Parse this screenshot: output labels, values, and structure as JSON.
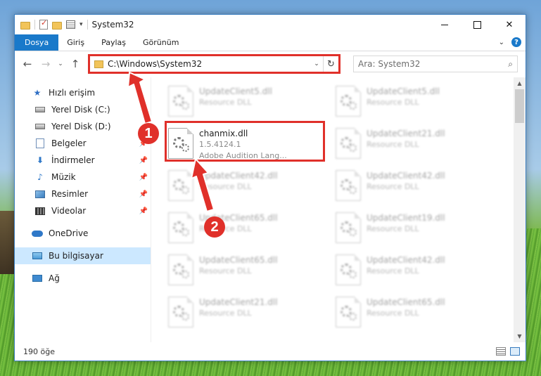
{
  "window": {
    "title": "System32",
    "controls": {
      "minimize": "",
      "maximize": "",
      "close": "✕"
    }
  },
  "quick_access_toolbar": {
    "dropdown": "▾"
  },
  "ribbon": {
    "tabs": [
      "Dosya",
      "Giriş",
      "Paylaş",
      "Görünüm"
    ],
    "expand_chevron": "⌄",
    "help": "?"
  },
  "nav": {
    "back": "←",
    "forward": "→",
    "recent": "⌄",
    "up": "↑",
    "address": "C:\\Windows\\System32",
    "address_dropdown": "⌄",
    "refresh": "↻",
    "search_placeholder": "Ara: System32",
    "search_icon": "⌕"
  },
  "sidebar": {
    "items": [
      {
        "label": "Hızlı erişim",
        "icon": "star-icon"
      },
      {
        "label": "Yerel Disk (C:)",
        "icon": "disk-icon"
      },
      {
        "label": "Yerel Disk (D:)",
        "icon": "disk-icon"
      },
      {
        "label": "Belgeler",
        "icon": "documents-icon",
        "pinned": true
      },
      {
        "label": "İndirmeler",
        "icon": "downloads-icon",
        "pinned": true
      },
      {
        "label": "Müzik",
        "icon": "music-icon",
        "pinned": true
      },
      {
        "label": "Resimler",
        "icon": "pictures-icon",
        "pinned": true
      },
      {
        "label": "Videolar",
        "icon": "videos-icon",
        "pinned": true
      },
      {
        "label": "OneDrive",
        "icon": "onedrive-icon"
      },
      {
        "label": "Bu bilgisayar",
        "icon": "this-pc-icon",
        "selected": true
      },
      {
        "label": "Ağ",
        "icon": "network-icon"
      }
    ],
    "pin_glyph": "📌"
  },
  "files": {
    "focused": {
      "name": "chanmix.dll",
      "version": "1.5.4124.1",
      "description": "Adobe Audition Lang..."
    },
    "blurred": [
      {
        "name": "UpdateClient5.dll",
        "type": "Resource DLL"
      },
      {
        "name": "UpdateClient5.dll",
        "type": "Resource DLL"
      },
      {
        "name": "UpdateClient21.dll",
        "type": "Resource DLL"
      },
      {
        "name": "UpdateClient42.dll",
        "type": "Resource DLL"
      },
      {
        "name": "UpdateClient42.dll",
        "type": "Resource DLL"
      },
      {
        "name": "UpdateClient65.dll",
        "type": "Resource DLL"
      },
      {
        "name": "UpdateClient19.dll",
        "type": "Resource DLL"
      },
      {
        "name": "UpdateClient65.dll",
        "type": "Resource DLL"
      },
      {
        "name": "UpdateClient42.dll",
        "type": "Resource DLL"
      },
      {
        "name": "UpdateClient21.dll",
        "type": "Resource DLL"
      },
      {
        "name": "UpdateClient65.dll",
        "type": "Resource DLL"
      }
    ]
  },
  "status": {
    "item_count": "190 öğe"
  },
  "annotations": {
    "step1": "1",
    "step2": "2",
    "color": "#e0302a"
  },
  "colors": {
    "accent": "#1979ca",
    "selection": "#cce8ff",
    "highlight": "#e0302a"
  }
}
